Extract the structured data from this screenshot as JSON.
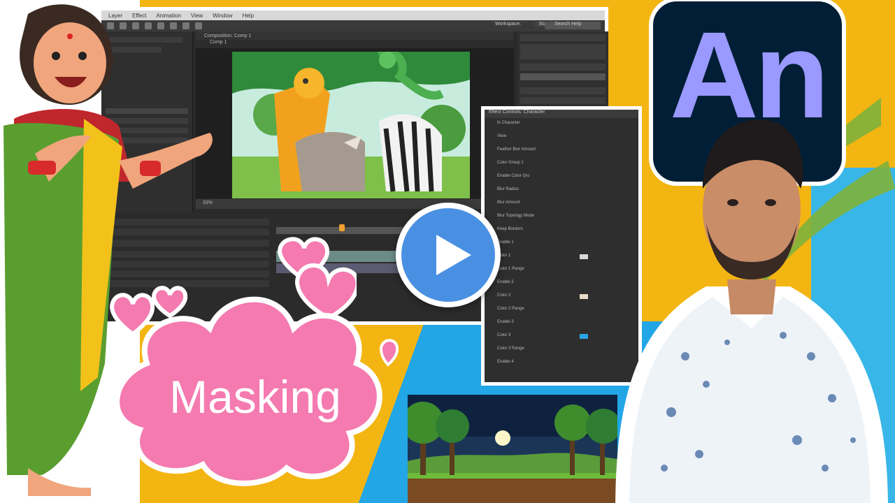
{
  "app": {
    "menu": [
      "Layer",
      "Effect",
      "Animation",
      "View",
      "Window",
      "Help"
    ],
    "workspace_label": "Workspace:",
    "workspace_value": "Standard",
    "search_placeholder": "Search Help",
    "comp_tab": "Composition: Comp 1",
    "comp_sub": "Comp 1",
    "zoom": "33%"
  },
  "effect_panel": {
    "header": "Effect Controls: Character",
    "rows": [
      {
        "label": "fx Character"
      },
      {
        "label": "View"
      },
      {
        "label": "Feather Blur Amount"
      },
      {
        "label": "Color Group 1"
      },
      {
        "label": "Enable Color Gro"
      },
      {
        "label": "Blur Radius"
      },
      {
        "label": "Blur Amount"
      },
      {
        "label": "Blur Topology Mode"
      },
      {
        "label": "Keep Borders"
      },
      {
        "label": "Enable 1"
      },
      {
        "label": "Color 1",
        "swatch": "#d9dad8"
      },
      {
        "label": "Color 1 Range"
      },
      {
        "label": "Enable 2"
      },
      {
        "label": "Color 2",
        "swatch": "#e8dcc8"
      },
      {
        "label": "Color 2 Range"
      },
      {
        "label": "Enable 3"
      },
      {
        "label": "Color 3",
        "swatch": "#29a6e3"
      },
      {
        "label": "Color 3 Range"
      },
      {
        "label": "Enable 4"
      }
    ]
  },
  "logo": {
    "text": "An",
    "bg": "#001e36",
    "fg": "#9999ff"
  },
  "sticker": {
    "text": "Masking",
    "color": "#f47ab0"
  },
  "colors": {
    "background": "#f3b512",
    "accent_blue": "#23a6e6",
    "play": "#4a90e2"
  },
  "icons": {
    "play": "play-icon",
    "heart": "heart-icon"
  }
}
